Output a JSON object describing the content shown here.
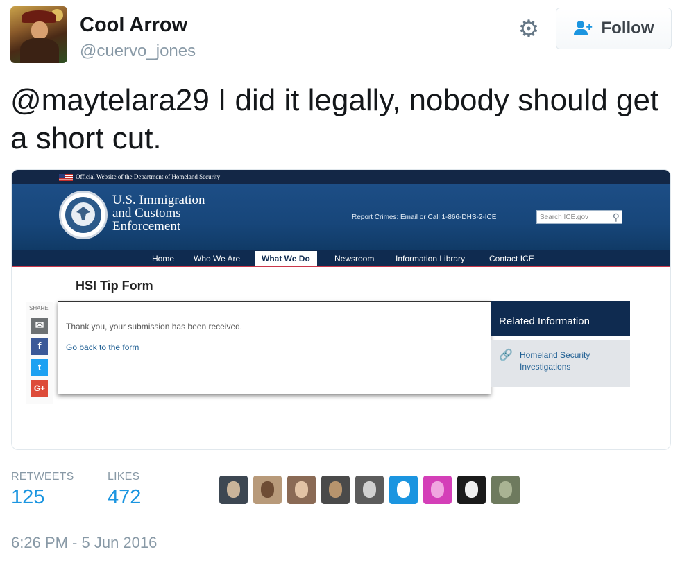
{
  "user": {
    "name": "Cool Arrow",
    "handle": "@cuervo_jones"
  },
  "actions": {
    "follow_label": "Follow"
  },
  "tweet": {
    "text": "@maytelara29 I did it legally, nobody should get a short cut."
  },
  "embedded_screenshot": {
    "dhs_banner": "Official Website of the Department of Homeland Security",
    "agency_title_lines": [
      "U.S. Immigration",
      "and Customs",
      "Enforcement"
    ],
    "report_text": "Report Crimes: Email or Call 1-866-DHS-2-ICE",
    "search_placeholder": "Search ICE.gov",
    "nav": [
      "Home",
      "Who We Are",
      "What We Do",
      "Newsroom",
      "Information Library",
      "Contact ICE"
    ],
    "active_nav": "What We Do",
    "page_title": "HSI Tip Form",
    "share_label": "SHARE",
    "share_buttons": [
      {
        "icon": "email-icon",
        "glyph": "✉",
        "color": "#6d7173"
      },
      {
        "icon": "facebook-icon",
        "glyph": "f",
        "color": "#3b5998"
      },
      {
        "icon": "twitter-icon",
        "glyph": "🐦",
        "color": "#1da1f2"
      },
      {
        "icon": "google-plus-icon",
        "glyph": "G+",
        "color": "#dd4b39"
      }
    ],
    "confirmation": "Thank you, your submission has been received.",
    "go_back_link": "Go back to the form",
    "related_heading": "Related Information",
    "related_link": "Homeland Security Investigations"
  },
  "stats": {
    "retweets_label": "RETWEETS",
    "retweets_value": "125",
    "likes_label": "LIKES",
    "likes_value": "472"
  },
  "likers": [
    {
      "name": "liker-avatar-1",
      "bg": "#3d4752",
      "fg": "#c9b49a"
    },
    {
      "name": "liker-avatar-2",
      "bg": "#b89a7a",
      "fg": "#6e4c34"
    },
    {
      "name": "liker-avatar-3",
      "bg": "#8a6a55",
      "fg": "#e2c3a5"
    },
    {
      "name": "liker-avatar-4",
      "bg": "#4a4a4a",
      "fg": "#b7946d"
    },
    {
      "name": "liker-avatar-5",
      "bg": "#5c5c5c",
      "fg": "#d0d0d0"
    },
    {
      "name": "liker-avatar-6",
      "bg": "#1b95e0",
      "fg": "#ffffff"
    },
    {
      "name": "liker-avatar-7",
      "bg": "#d43fb8",
      "fg": "#f0a6e0"
    },
    {
      "name": "liker-avatar-8",
      "bg": "#1a1a1a",
      "fg": "#eeeeee"
    },
    {
      "name": "liker-avatar-9",
      "bg": "#6e7a5e",
      "fg": "#a9b393"
    }
  ],
  "timestamp": "6:26 PM - 5 Jun 2016"
}
